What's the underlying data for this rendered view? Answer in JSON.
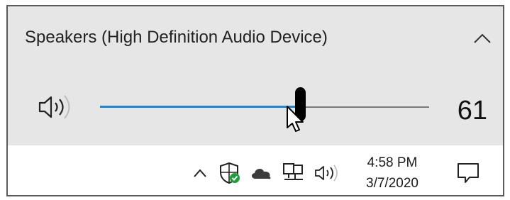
{
  "flyout": {
    "device_name": "Speakers (High Definition Audio Device)",
    "collapse_icon": "chevron-up-icon",
    "speaker_icon": "speaker-volume-icon",
    "volume": {
      "value": 61,
      "label": "61",
      "max": 100
    },
    "accent_color": "#1e84d8"
  },
  "taskbar": {
    "tray_icons": [
      "chevron-up-icon",
      "windows-security-icon",
      "onedrive-cloud-icon",
      "network-icon",
      "volume-icon",
      "action-center-icon"
    ],
    "clock": {
      "time": "4:58 PM",
      "date": "3/7/2020"
    }
  }
}
